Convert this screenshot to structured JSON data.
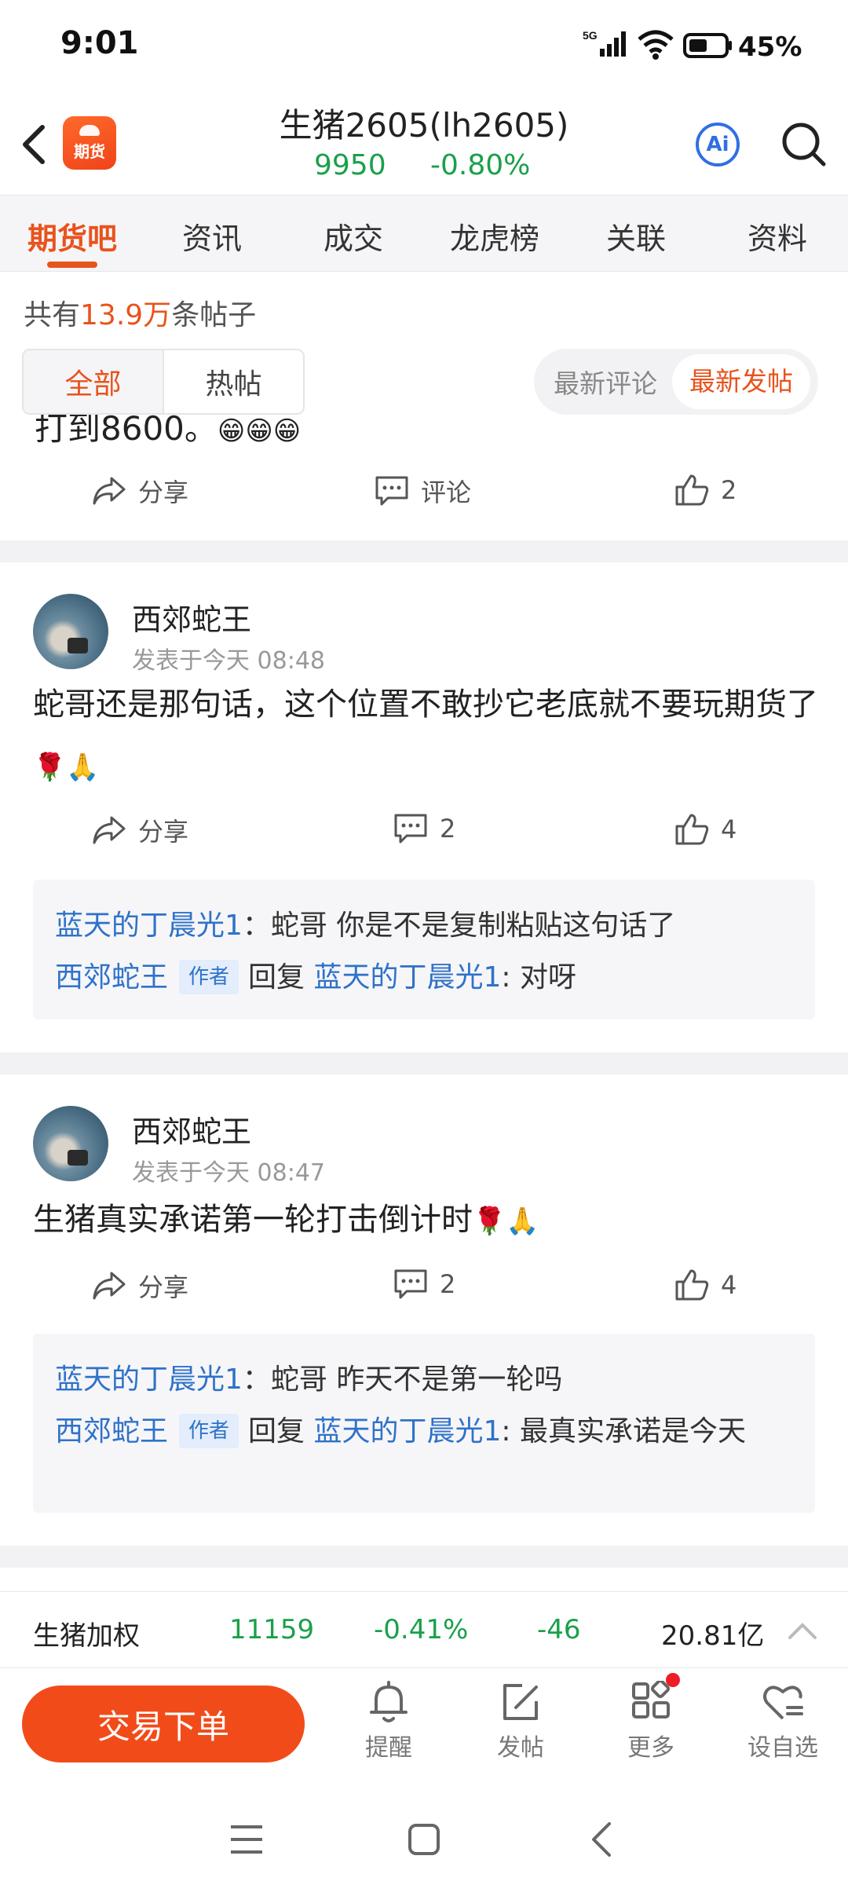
{
  "status_bar": {
    "time": "9:01",
    "network": "5G",
    "battery": "45%"
  },
  "header": {
    "logo_text": "期货",
    "title": "生猪2605(lh2605)",
    "price": "9950",
    "change": "-0.80%",
    "ai_label": "Ai"
  },
  "tabs": [
    "期货吧",
    "资讯",
    "成交",
    "龙虎榜",
    "关联",
    "资料"
  ],
  "post_count": {
    "prefix": "共有",
    "count": "13.9万",
    "suffix": "条帖子"
  },
  "filters": {
    "all": "全部",
    "hot": "热帖"
  },
  "sort": {
    "latest_comment": "最新评论",
    "latest_post": "最新发帖"
  },
  "partial_post": {
    "text": "打到8600。",
    "emojis": "😁😁😁",
    "share": "分享",
    "comment": "评论",
    "likes": "2"
  },
  "posts": [
    {
      "username": "西郊蛇王",
      "time": "发表于今天 08:48",
      "content": "蛇哥还是那句话，这个位置不敢抄它老底就不要玩期货了",
      "emojis": "🌹🙏",
      "share": "分享",
      "comments": "2",
      "likes": "4",
      "replies": [
        {
          "user": "蓝天的丁晨光1",
          "text": "：蛇哥 你是不是复制粘贴这句话了"
        },
        {
          "user": "西郊蛇王",
          "badge": "作者",
          "reply_word": "回复",
          "target": "蓝天的丁晨光1",
          "text": ": 对呀"
        }
      ]
    },
    {
      "username": "西郊蛇王",
      "time": "发表于今天 08:47",
      "content": "生猪真实承诺第一轮打击倒计时",
      "emojis": "🌹🙏",
      "share": "分享",
      "comments": "2",
      "likes": "4",
      "replies": [
        {
          "user": "蓝天的丁晨光1",
          "text": "：蛇哥 昨天不是第一轮吗"
        },
        {
          "user": "西郊蛇王",
          "badge": "作者",
          "reply_word": "回复",
          "target": "蓝天的丁晨光1",
          "text": ": 最真实承诺是今天"
        }
      ]
    }
  ],
  "ticker": {
    "name": "生猪加权",
    "price": "11159",
    "pct": "-0.41%",
    "change": "-46",
    "volume": "20.81亿"
  },
  "bottom_nav": {
    "trade": "交易下单",
    "remind": "提醒",
    "post": "发帖",
    "more": "更多",
    "watch": "设自选"
  },
  "colors": {
    "accent": "#e8531c",
    "down": "#1aa04a",
    "link": "#2f72c9",
    "trade_button": "#f24b1a"
  }
}
